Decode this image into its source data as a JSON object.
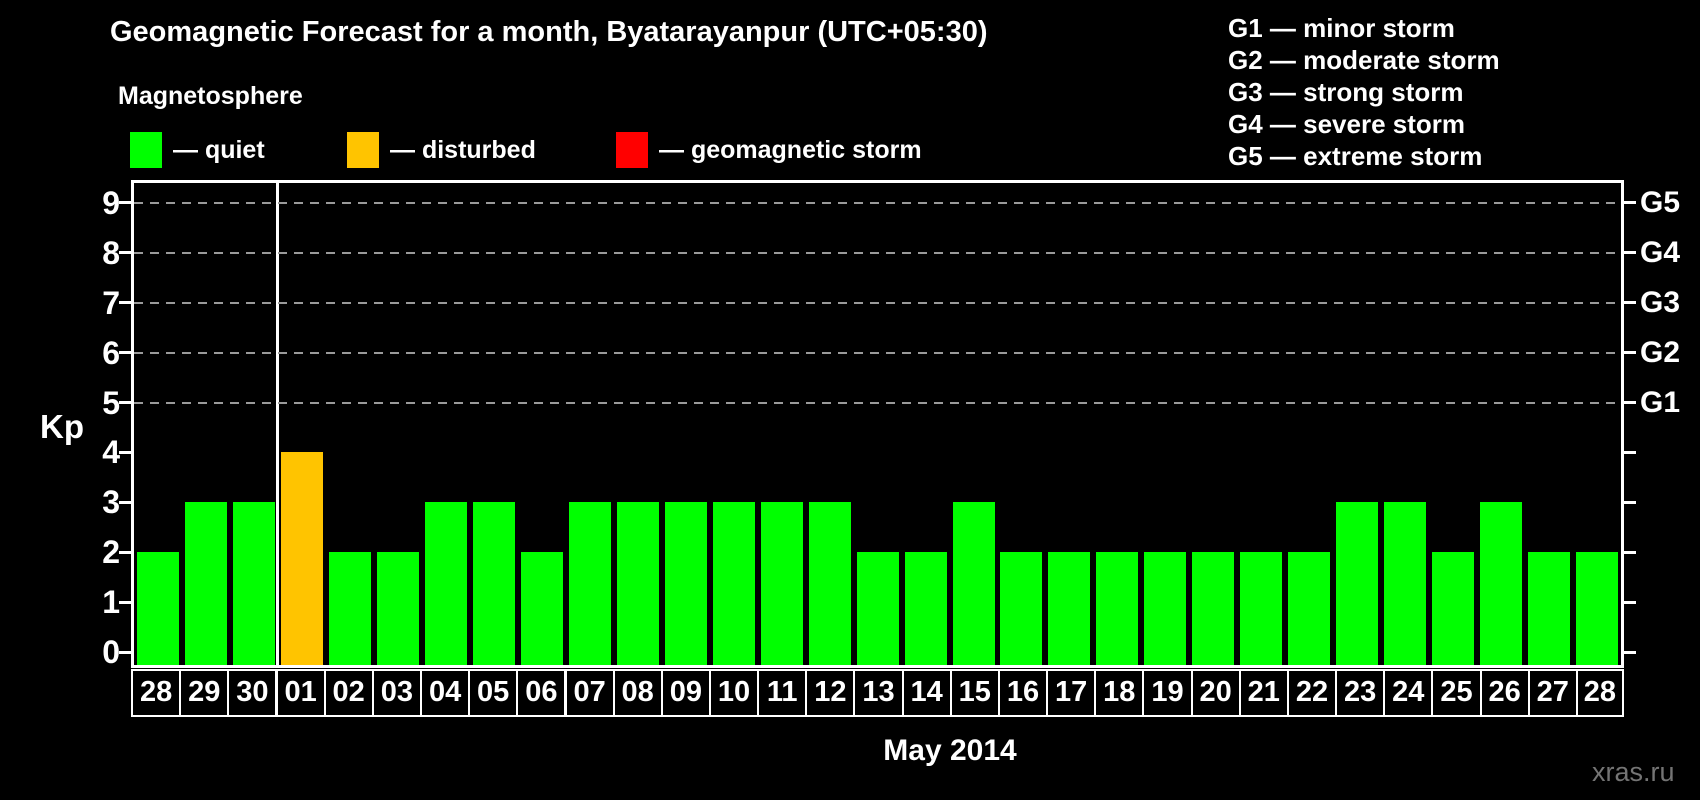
{
  "title": "Geomagnetic Forecast for a month, Byatarayanpur (UTC+05:30)",
  "storm_scale_legend": {
    "items": [
      "G1 — minor storm",
      "G2 — moderate storm",
      "G3 — strong storm",
      "G4 — severe storm",
      "G5 — extreme storm"
    ]
  },
  "magnetosphere_legend": {
    "title": "Magnetosphere",
    "items": [
      {
        "label": "— quiet",
        "color": "#00ff00"
      },
      {
        "label": "— disturbed",
        "color": "#ffc400"
      },
      {
        "label": "— geomagnetic storm",
        "color": "#ff0000"
      }
    ]
  },
  "watermark": "xras.ru",
  "colors": {
    "background": "#000000",
    "foreground": "#ffffff",
    "gridline": "#9a9a9a",
    "watermark": "#747474",
    "quiet": "#00ff00",
    "disturbed": "#ffc400",
    "storm": "#ff0000"
  },
  "chart_data": {
    "type": "bar",
    "title": "Geomagnetic Forecast for a month, Byatarayanpur (UTC+05:30)",
    "xlabel": "May 2014",
    "ylabel": "Kp",
    "ylim": [
      0,
      9
    ],
    "grid": true,
    "legend_position": "top",
    "categories": [
      "28",
      "29",
      "30",
      "01",
      "02",
      "03",
      "04",
      "05",
      "06",
      "07",
      "08",
      "09",
      "10",
      "11",
      "12",
      "13",
      "14",
      "15",
      "16",
      "17",
      "18",
      "19",
      "20",
      "21",
      "22",
      "23",
      "24",
      "25",
      "26",
      "27",
      "28"
    ],
    "values": [
      2,
      3,
      3,
      4,
      2,
      2,
      3,
      3,
      2,
      3,
      3,
      3,
      3,
      3,
      3,
      2,
      2,
      3,
      2,
      2,
      2,
      2,
      2,
      2,
      2,
      3,
      3,
      2,
      3,
      2,
      2
    ],
    "statuses": [
      "quiet",
      "quiet",
      "quiet",
      "disturbed",
      "quiet",
      "quiet",
      "quiet",
      "quiet",
      "quiet",
      "quiet",
      "quiet",
      "quiet",
      "quiet",
      "quiet",
      "quiet",
      "quiet",
      "quiet",
      "quiet",
      "quiet",
      "quiet",
      "quiet",
      "quiet",
      "quiet",
      "quiet",
      "quiet",
      "quiet",
      "quiet",
      "quiet",
      "quiet",
      "quiet",
      "quiet"
    ],
    "yticks_left": [
      0,
      1,
      2,
      3,
      4,
      5,
      6,
      7,
      8,
      9
    ],
    "gridlines_at_kp": [
      5,
      6,
      7,
      8,
      9
    ],
    "right_axis_labels": [
      {
        "label": "G1",
        "kp": 5
      },
      {
        "label": "G2",
        "kp": 6
      },
      {
        "label": "G3",
        "kp": 7
      },
      {
        "label": "G4",
        "kp": 8
      },
      {
        "label": "G5",
        "kp": 9
      }
    ],
    "month_boundary_index": 3
  }
}
